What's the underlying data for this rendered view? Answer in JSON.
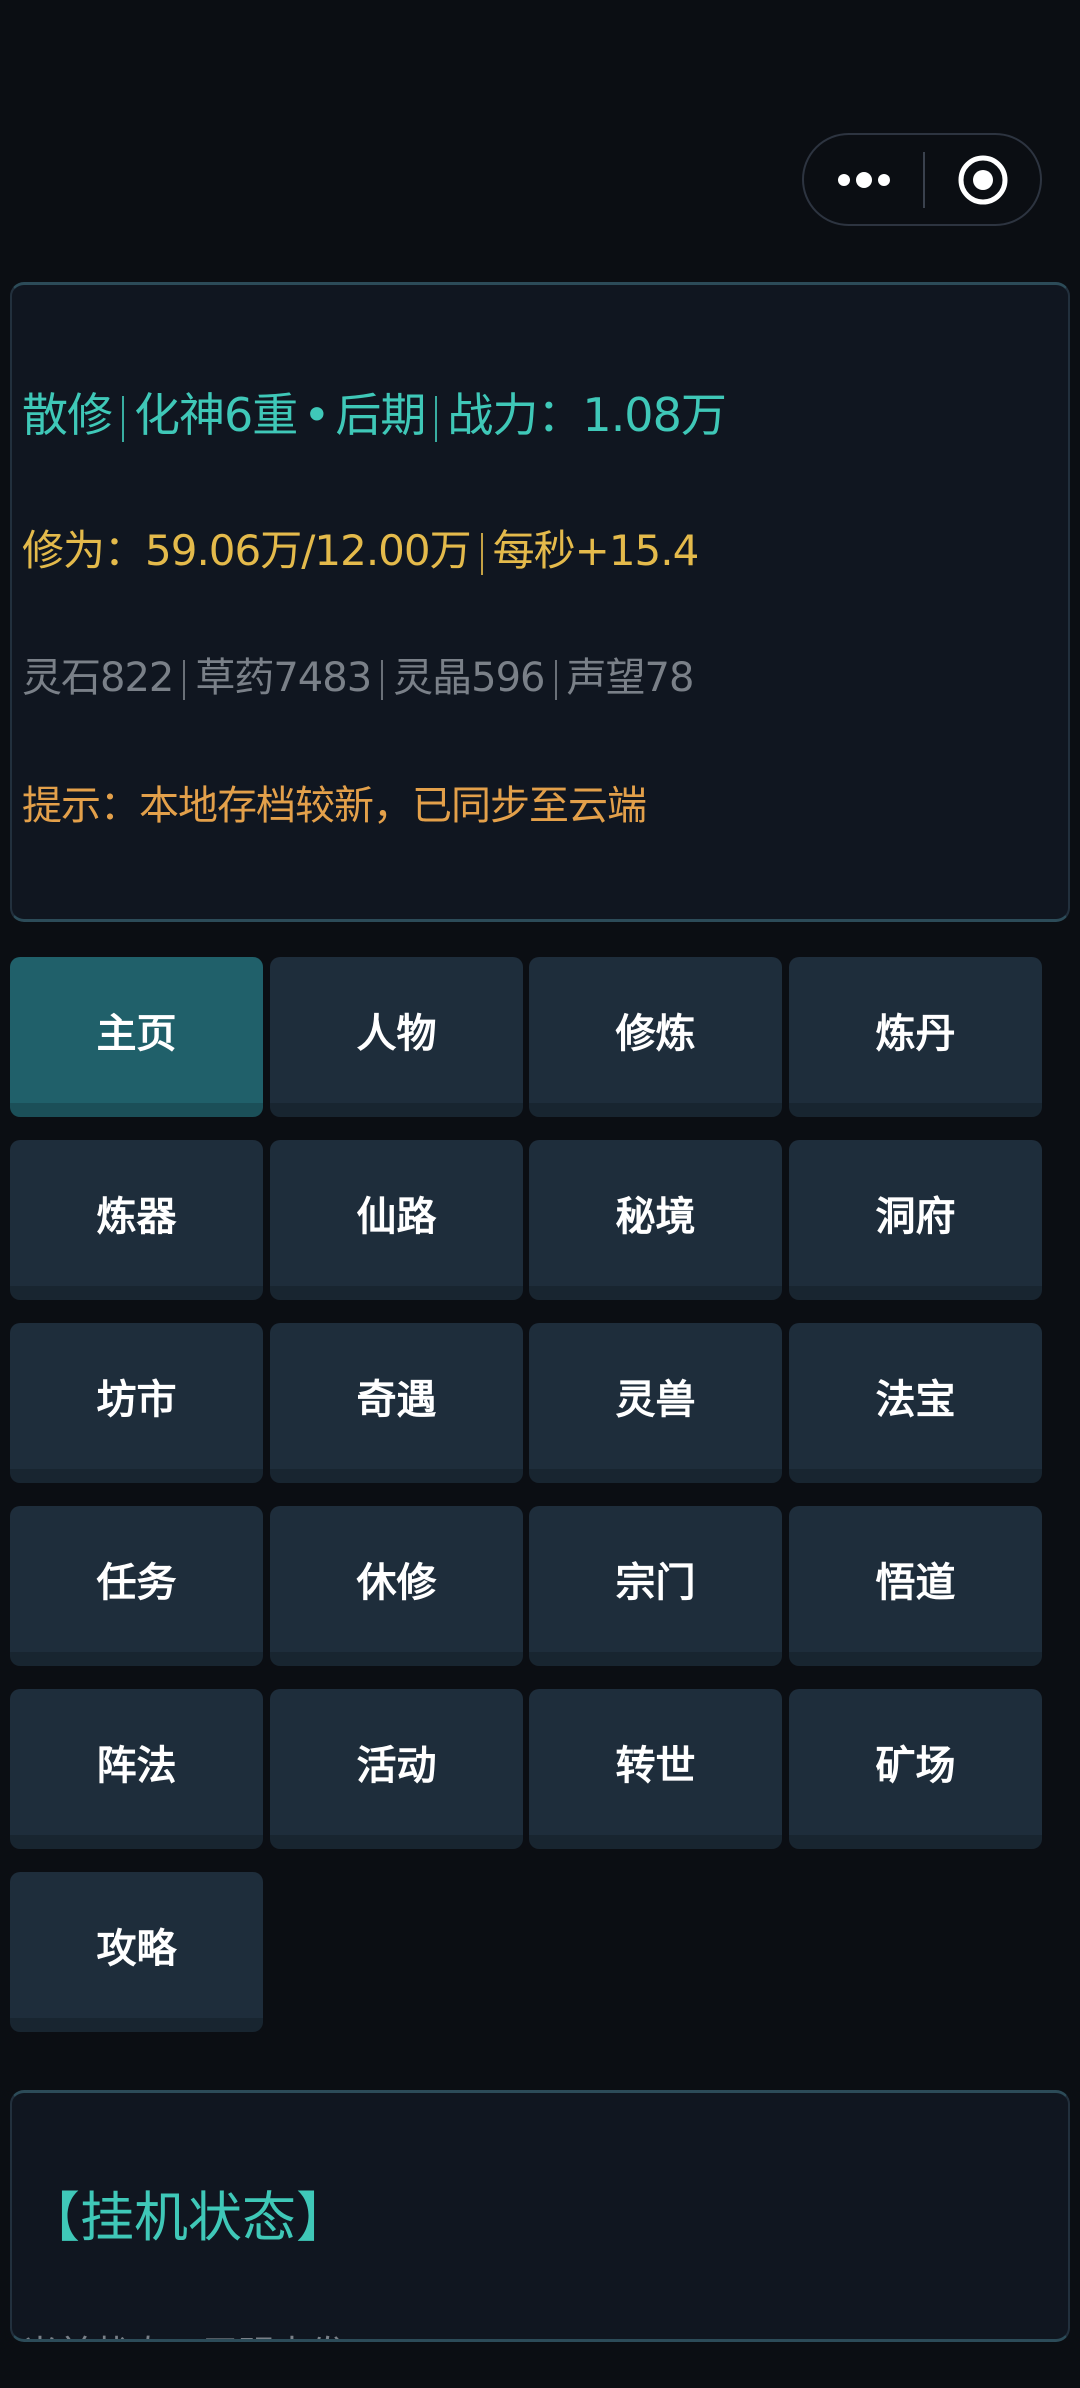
{
  "capsule": {
    "more_icon": "more-dots-icon",
    "close_icon": "target-circle-icon"
  },
  "status": {
    "identity": "散修",
    "realm": "化神6重",
    "stage": "后期",
    "power": "战力：1.08万",
    "cultivation": "修为：59.06万/12.00万",
    "rate": "每秒+15.4",
    "spirit_stone": "灵石822",
    "herbs": "草药7483",
    "spirit_crystal": "灵晶596",
    "reputation": "声望78",
    "hint": "提示：本地存档较新，已同步至云端",
    "dot": "•"
  },
  "nav": {
    "items": [
      {
        "label": "主页",
        "active": true
      },
      {
        "label": "人物",
        "active": false
      },
      {
        "label": "修炼",
        "active": false
      },
      {
        "label": "炼丹",
        "active": false
      },
      {
        "label": "炼器",
        "active": false
      },
      {
        "label": "仙路",
        "active": false
      },
      {
        "label": "秘境",
        "active": false
      },
      {
        "label": "洞府",
        "active": false
      },
      {
        "label": "坊市",
        "active": false
      },
      {
        "label": "奇遇",
        "active": false
      },
      {
        "label": "灵兽",
        "active": false
      },
      {
        "label": "法宝",
        "active": false
      },
      {
        "label": "任务",
        "active": false
      },
      {
        "label": "休修",
        "active": false
      },
      {
        "label": "宗门",
        "active": false
      },
      {
        "label": "悟道",
        "active": false
      },
      {
        "label": "阵法",
        "active": false
      },
      {
        "label": "活动",
        "active": false
      },
      {
        "label": "转世",
        "active": false
      },
      {
        "label": "矿场",
        "active": false
      },
      {
        "label": "攻略",
        "active": false
      }
    ]
  },
  "idle": {
    "title": "【挂机状态】",
    "subtitle": "当前状态：无明出发"
  },
  "colors": {
    "background": "#0b0e13",
    "panel": "#101620",
    "accent_teal": "#3fc8b8",
    "gold": "#e4ba4b",
    "orange": "#e3a04a",
    "button": "#1e2d3b",
    "button_active": "#20606a"
  }
}
